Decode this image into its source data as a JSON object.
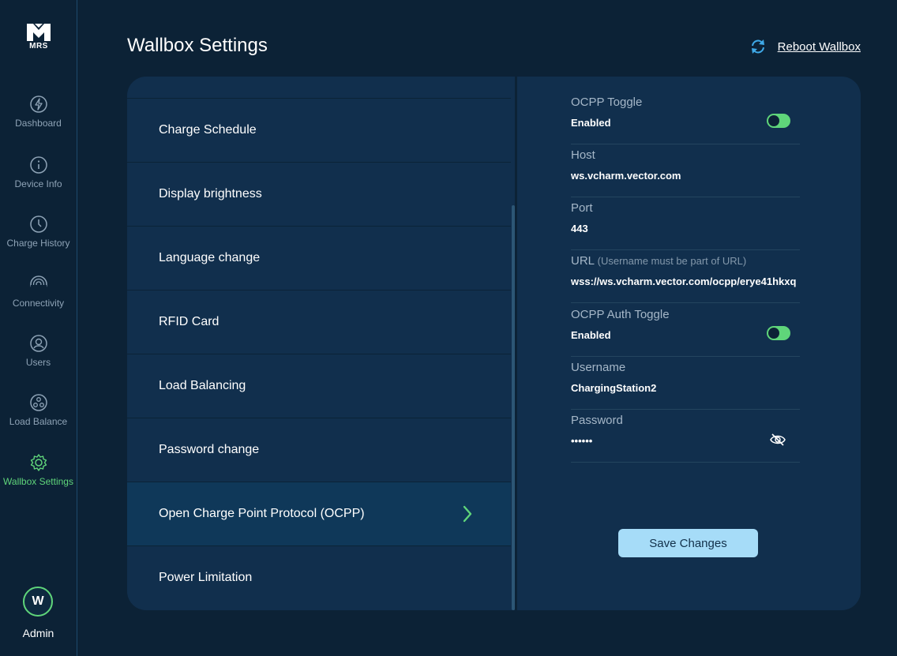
{
  "app": {
    "logo_text": "MRS",
    "title": "Wallbox Settings",
    "reboot_label": "Reboot Wallbox"
  },
  "nav": [
    {
      "label": "Dashboard",
      "icon": "bolt-icon"
    },
    {
      "label": "Device Info",
      "icon": "info-icon"
    },
    {
      "label": "Charge History",
      "icon": "clock-icon"
    },
    {
      "label": "Connectivity",
      "icon": "signal-icon"
    },
    {
      "label": "Users",
      "icon": "user-icon"
    },
    {
      "label": "Load Balance",
      "icon": "load-balance-icon"
    },
    {
      "label": "Wallbox Settings",
      "icon": "gear-icon",
      "active": true
    }
  ],
  "user": {
    "initial": "W",
    "name": "Admin"
  },
  "settings_list": [
    {
      "label": "Charge Schedule"
    },
    {
      "label": "Display brightness"
    },
    {
      "label": "Language change"
    },
    {
      "label": "RFID Card"
    },
    {
      "label": "Load Balancing"
    },
    {
      "label": "Password change"
    },
    {
      "label": "Open Charge Point Protocol (OCPP)",
      "selected": true
    },
    {
      "label": "Power Limitation"
    }
  ],
  "ocpp": {
    "toggle": {
      "label": "OCPP Toggle",
      "value": "Enabled",
      "on": true
    },
    "host": {
      "label": "Host",
      "value": "ws.vcharm.vector.com"
    },
    "port": {
      "label": "Port",
      "value": "443"
    },
    "url": {
      "label": "URL",
      "hint": "(Username must be part of URL)",
      "value": "wss://ws.vcharm.vector.com/ocpp/erye41hkxq"
    },
    "auth_toggle": {
      "label": "OCPP Auth Toggle",
      "value": "Enabled",
      "on": true
    },
    "username": {
      "label": "Username",
      "value": "ChargingStation2"
    },
    "password": {
      "label": "Password",
      "value": "••••••"
    },
    "save_label": "Save Changes"
  },
  "colors": {
    "accent": "#5fd57a",
    "background": "#0c2236",
    "panel": "#112f4d",
    "button": "#a6dcf8"
  }
}
